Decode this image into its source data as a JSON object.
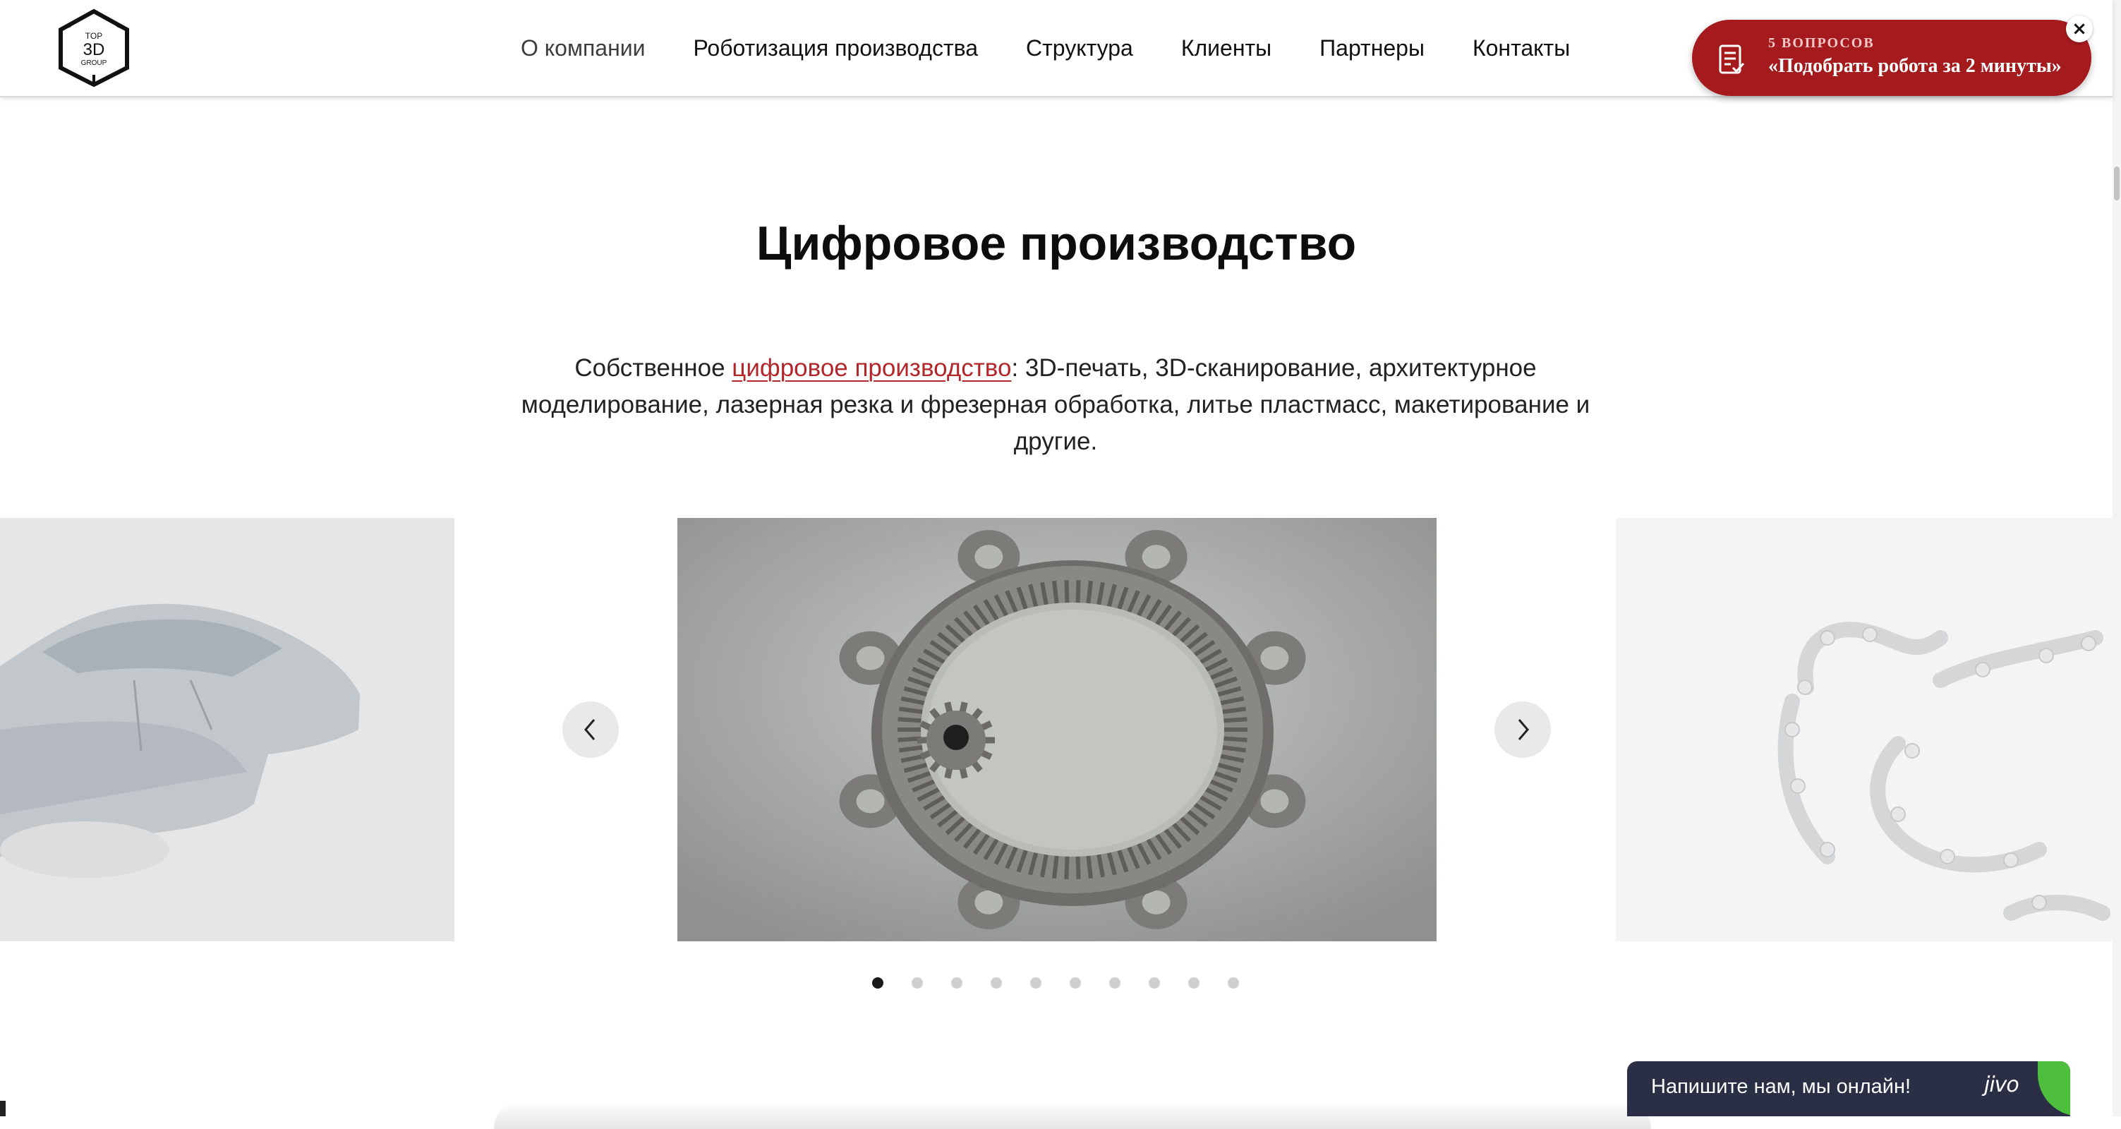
{
  "header": {
    "logo": {
      "line1": "TOP",
      "line2": "3D",
      "line3": "GROUP"
    },
    "nav": [
      "О компании",
      "Роботизация производства",
      "Структура",
      "Клиенты",
      "Партнеры",
      "Контакты"
    ],
    "quiz": {
      "small": "5 ВОПРОСОВ",
      "big": "«Подобрать робота за 2 минуты»",
      "color": "#a51a1d"
    },
    "quiz_close": "×"
  },
  "section": {
    "title": "Цифровое производство",
    "desc_before": "Собственное ",
    "desc_link": "цифровое производство",
    "desc_after": ": 3D-печать, 3D-сканирование, архитектурное моделирование, лазерная резка и фрезерная обработка, литье пластмасс, макетирование и другие.",
    "link_color": "#b3262a"
  },
  "slider": {
    "slides": [
      "car-body-model",
      "internal-gear-ring",
      "dental-aligners"
    ],
    "dot_count": 10,
    "active_dot": 1
  },
  "chat": {
    "text": "Напишите нам, мы онлайн!",
    "brand": "jivo"
  }
}
